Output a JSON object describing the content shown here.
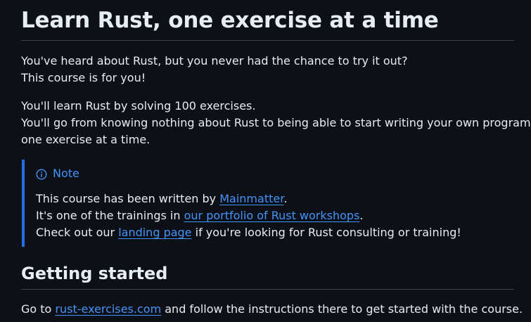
{
  "title": "Learn Rust, one exercise at a time",
  "intro": {
    "line1": "You've heard about Rust, but you never had the chance to try it out?",
    "line2": "This course is for you!"
  },
  "learn": {
    "line1": "You'll learn Rust by solving 100 exercises.",
    "line2": "You'll go from knowing nothing about Rust to being able to start writing your own programs,",
    "line3": "one exercise at a time."
  },
  "note": {
    "label": "Note",
    "icon": "info-icon",
    "accent_color": "#1f6feb",
    "line1_before": "This course has been written by ",
    "line1_link": "Mainmatter",
    "line1_after": ".",
    "line2_before": "It's one of the trainings in ",
    "line2_link": "our portfolio of Rust workshops",
    "line2_after": ".",
    "line3_before": "Check out our ",
    "line3_link": "landing page",
    "line3_after": " if you're looking for Rust consulting or training!"
  },
  "getting_started": {
    "heading": "Getting started",
    "text_before": "Go to ",
    "link": "rust-exercises.com",
    "text_after": " and follow the instructions there to get started with the course."
  },
  "colors": {
    "background": "#0d1117",
    "text": "#e6edf3",
    "link": "#4493f8",
    "divider": "#3d444d"
  }
}
